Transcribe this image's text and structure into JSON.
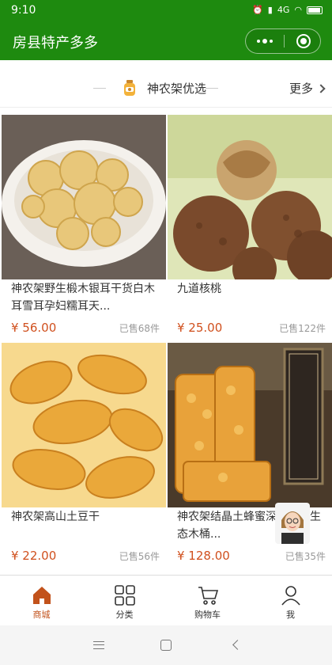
{
  "status_bar": {
    "time": "9:10",
    "battery_icon": "battery-icon",
    "signal": "4G"
  },
  "header": {
    "title": "房县特产多多",
    "theme_color": "#1e8a0f"
  },
  "section": {
    "title": "神农架优选",
    "more_label": "更多",
    "icon": "honey-jar-icon"
  },
  "products": [
    {
      "name": "神农架野生椴木银耳干货白木耳雪耳孕妇糯耳天...",
      "price": "¥ 56.00",
      "sold": "已售68件",
      "image": "silver-fungus-image"
    },
    {
      "name": "九道核桃",
      "price": "¥ 25.00",
      "sold": "已售122件",
      "image": "walnut-image"
    },
    {
      "name": "神农架高山土豆干",
      "price": "¥ 22.00",
      "sold": "已售56件",
      "image": "dried-potato-image"
    },
    {
      "name": "神农架结晶土蜂蜜深山农家生态木桶...",
      "price": "¥ 128.00",
      "sold": "已售35件",
      "image": "honeycomb-image"
    }
  ],
  "tabs": [
    {
      "label": "商城",
      "icon": "home-icon",
      "active": true
    },
    {
      "label": "分类",
      "icon": "category-grid-icon",
      "active": false
    },
    {
      "label": "购物车",
      "icon": "cart-icon",
      "active": false
    },
    {
      "label": "我",
      "icon": "user-icon",
      "active": false
    }
  ],
  "colors": {
    "price": "#d0501e",
    "tab_active": "#c2521b",
    "header": "#1e8a0f"
  }
}
